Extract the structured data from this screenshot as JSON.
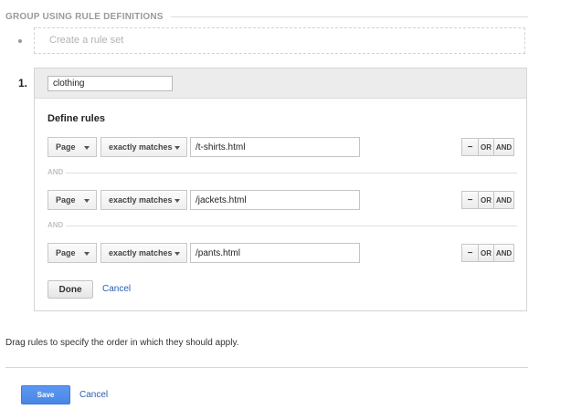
{
  "section": {
    "title": "GROUP USING RULE DEFINITIONS"
  },
  "create_rule_set": {
    "label": "Create a rule set"
  },
  "rule_set": {
    "number": "1.",
    "name_value": "clothing",
    "define_rules_label": "Define rules",
    "rules": [
      {
        "dimension": "Page",
        "operator": "exactly matches",
        "value": "/t-shirts.html"
      },
      {
        "dimension": "Page",
        "operator": "exactly matches",
        "value": "/jackets.html"
      },
      {
        "dimension": "Page",
        "operator": "exactly matches",
        "value": "/pants.html"
      }
    ],
    "rule_buttons": {
      "minus": "−",
      "or": "OR",
      "and": "AND"
    },
    "separator_label": "AND",
    "done_label": "Done",
    "cancel_label": "Cancel"
  },
  "drag_hint": "Drag rules to specify the order in which they should apply.",
  "footer": {
    "save_label": "Save",
    "cancel_label": "Cancel"
  },
  "colors": {
    "link": "#2a5db0",
    "primary_button": "#4a86e6",
    "panel_header": "#ececec"
  },
  "icons": {
    "dropdown": "caret-down-icon",
    "bullet": "bullet-icon"
  }
}
